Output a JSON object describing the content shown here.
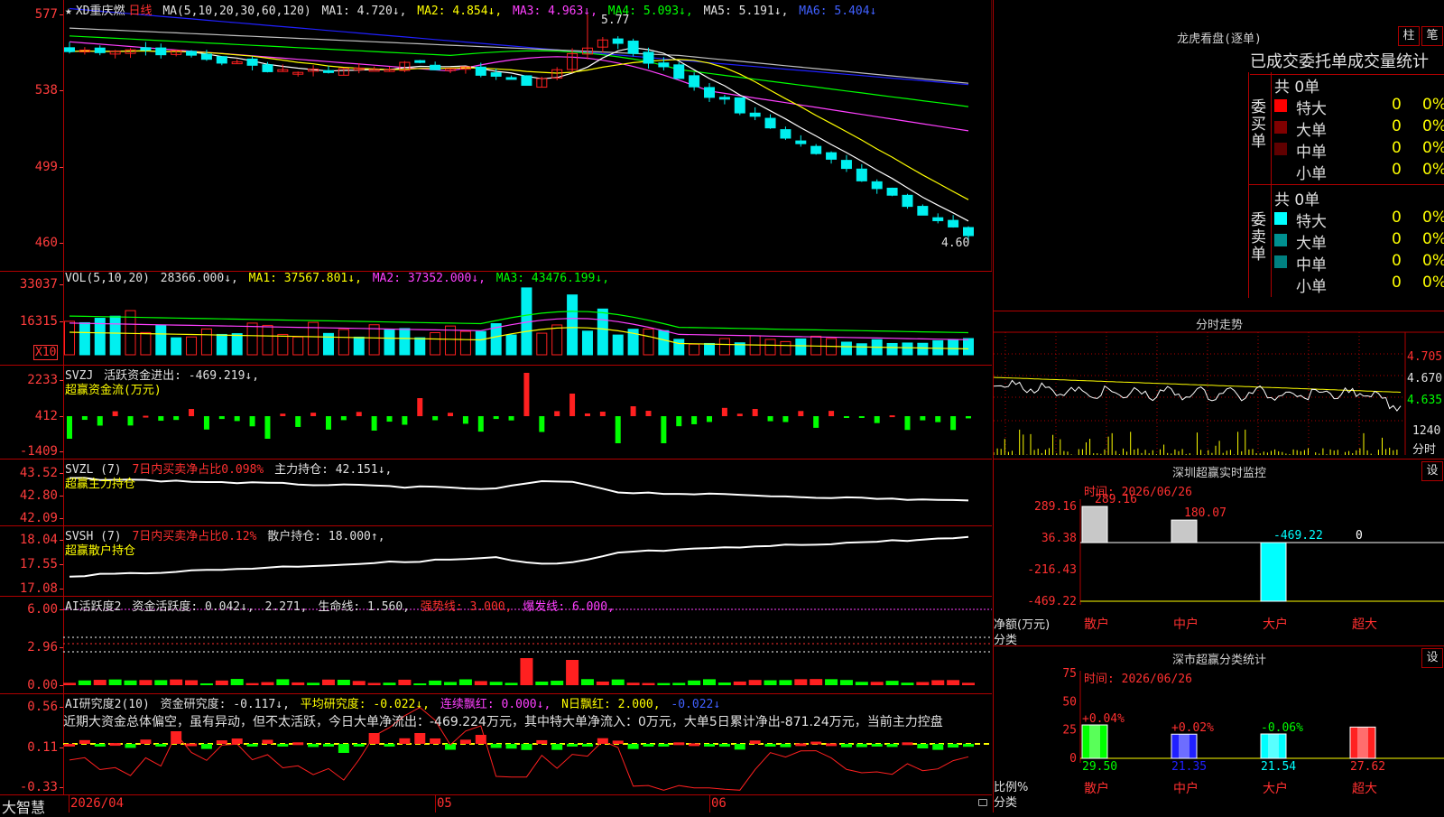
{
  "colors": {
    "up": "#ff2020",
    "down": "#00f0f0",
    "ma1": "#ffffff",
    "ma2": "#ffff00",
    "ma3": "#ff40ff",
    "ma4": "#00ff00",
    "ma5": "#c0c0c0",
    "ma6": "#2020ff",
    "grid": "#b00000"
  },
  "main": {
    "star": "★",
    "stock": "XD重庆燃",
    "period": "日线",
    "ma_params": "MA(5,10,20,30,60,120)",
    "ma1": "MA1: 4.720↓,",
    "ma2": "MA2: 4.854↓,",
    "ma3": "MA3: 4.963↓,",
    "ma4": "MA4: 5.093↓,",
    "ma5": "MA5: 5.191↓,",
    "ma6": "MA6: 5.404↓",
    "high_label": "5.77",
    "low_label": "4.60",
    "yticks": [
      "577",
      "538",
      "499",
      "460"
    ]
  },
  "vol": {
    "params": "VOL(5,10,20)",
    "value": "28366.000↓,",
    "ma1": "MA1: 37567.801↓,",
    "ma2": "MA2: 37352.000↓,",
    "ma3": "MA3: 43476.199↓,",
    "yticks": [
      "33037",
      "16315"
    ],
    "unit": "X10"
  },
  "svzj": {
    "name": "SVZJ",
    "label": "活跃资金进出: -469.219↓,",
    "sub": "超赢资金流(万元)",
    "yticks": [
      "2233",
      "412",
      "-1409"
    ]
  },
  "svzl": {
    "name": "SVZL (7)",
    "pct": "7日内买卖净占比0.098%",
    "hold": "主力持仓: 42.151↓,",
    "sub": "超赢主力持仓",
    "yticks": [
      "43.52",
      "42.80",
      "42.09"
    ]
  },
  "svsh": {
    "name": "SVSH (7)",
    "pct": "7日内买卖净占比0.12%",
    "hold": "散户持仓: 18.000↑,",
    "sub": "超赢散户持仓",
    "yticks": [
      "18.04",
      "17.55",
      "17.08"
    ]
  },
  "ai1": {
    "name": "AI活跃度2",
    "a": "资金活跃度: 0.042↓,",
    "b": "2.271,",
    "c": "生命线: 1.560,",
    "d": "强势线: 3.000,",
    "e": "爆发线: 6.000,",
    "yticks": [
      "6.00",
      "2.96",
      "0.00"
    ]
  },
  "ai2": {
    "name": "AI研究度2(10)",
    "a": "资金研究度: -0.117↓,",
    "b": "平均研究度: -0.022↓,",
    "c": "连续飘红: 0.000↓,",
    "d": "N日飘红: 2.000,",
    "e": "-0.022↓",
    "text": "近期大资金总体偏空，虽有异动，但不太活跃，今日大单净流出：-469.224万元，其中特大单净流入：0万元，大单5日累计净出-871.24万元，当前主力控盘",
    "yticks": [
      "0.56",
      "0.11",
      "-0.33"
    ]
  },
  "xaxis": {
    "brand": "大智慧",
    "date": "2026/04",
    "m05": "05",
    "m06": "06"
  },
  "dragon": {
    "title": "龙虎看盘(逐单)",
    "btn1": "柱",
    "btn2": "笔",
    "subtitle": "已成交委托单成交量统计",
    "buy": {
      "side": "委买单",
      "total": "共 0单",
      "rows": [
        {
          "name": "特大",
          "n": "0",
          "p": "0%",
          "c": "#ff0000"
        },
        {
          "name": "大单",
          "n": "0",
          "p": "0%",
          "c": "#800000"
        },
        {
          "name": "中单",
          "n": "0",
          "p": "0%",
          "c": "#600000"
        },
        {
          "name": "小单",
          "n": "0",
          "p": "0%",
          "c": ""
        }
      ]
    },
    "sell": {
      "side": "委卖单",
      "total": "共 0单",
      "rows": [
        {
          "name": "特大",
          "n": "0",
          "p": "0%",
          "c": "#00ffff"
        },
        {
          "name": "大单",
          "n": "0",
          "p": "0%",
          "c": "#009090"
        },
        {
          "name": "中单",
          "n": "0",
          "p": "0%",
          "c": "#008080"
        },
        {
          "name": "小单",
          "n": "0",
          "p": "0%",
          "c": ""
        }
      ]
    }
  },
  "intraday": {
    "title": "分时走势",
    "yticks": [
      "4.705",
      "4.670",
      "4.635"
    ],
    "vol_label": "1240",
    "sub": "分时"
  },
  "monitor": {
    "title": "深圳超赢实时监控",
    "btn": "设",
    "time": "时间: 2026/06/26",
    "yticks": [
      "289.16",
      "36.38",
      "-216.43",
      "-469.22"
    ],
    "y_title": "净额(万元)",
    "x_title": "分类",
    "bars": [
      {
        "name": "散户",
        "value": 289.16,
        "label": "289.16"
      },
      {
        "name": "中户",
        "value": 180.07,
        "label": "180.07"
      },
      {
        "name": "大户",
        "value": -469.22,
        "label": "-469.22"
      },
      {
        "name": "超大",
        "value": 0,
        "label": "0"
      }
    ]
  },
  "classify": {
    "title": "深市超赢分类统计",
    "btn": "设",
    "time": "时间: 2026/06/26",
    "yticks": [
      "75",
      "50",
      "25",
      "0"
    ],
    "y_title": "比例%",
    "x_title": "分类",
    "bars": [
      {
        "name": "散户",
        "value": 29.5,
        "label": "29.50",
        "chg": "+0.04%"
      },
      {
        "name": "中户",
        "value": 21.35,
        "label": "21.35",
        "chg": "+0.02%"
      },
      {
        "name": "大户",
        "value": 21.54,
        "label": "21.54",
        "chg": "-0.06%"
      },
      {
        "name": "超大",
        "value": 27.62,
        "label": "27.62",
        "chg": ""
      }
    ]
  }
}
